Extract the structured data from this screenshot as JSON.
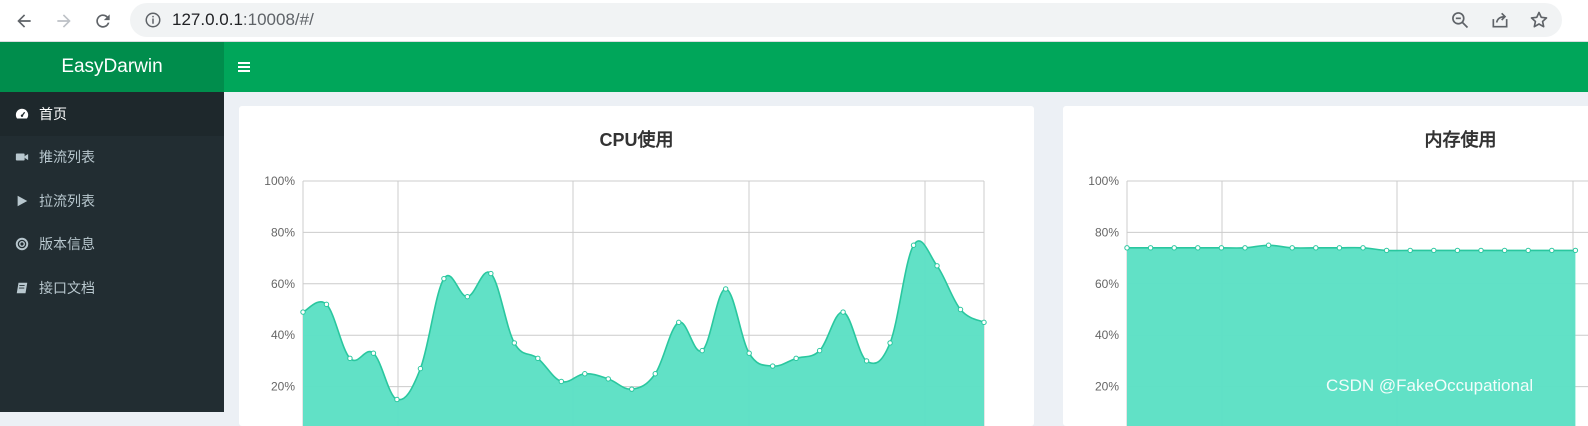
{
  "browser": {
    "url_host": "127.0.0.1",
    "url_rest": ":10008/#/"
  },
  "header": {
    "logo": "EasyDarwin"
  },
  "sidebar": {
    "items": [
      {
        "label": "首页",
        "icon": "dashboard-icon",
        "active": true
      },
      {
        "label": "推流列表",
        "icon": "video-camera-icon",
        "active": false
      },
      {
        "label": "拉流列表",
        "icon": "play-icon",
        "active": false
      },
      {
        "label": "版本信息",
        "icon": "life-ring-icon",
        "active": false
      },
      {
        "label": "接口文档",
        "icon": "book-icon",
        "active": false
      }
    ]
  },
  "colors": {
    "header": "#00a65a",
    "logo_bg": "#008d4c",
    "sidebar": "#222d32",
    "area_fill": "#5ce0c4",
    "area_line": "#2ac79f"
  },
  "chart_data": [
    {
      "type": "area",
      "title": "CPU使用",
      "ylim": [
        0,
        100
      ],
      "y_ticks": [
        "100%",
        "80%",
        "60%",
        "40%",
        "20%"
      ],
      "grid": true,
      "x": [
        0,
        1,
        2,
        3,
        4,
        5,
        6,
        7,
        8,
        9,
        10,
        11,
        12,
        13,
        14,
        15,
        16,
        17,
        18,
        19,
        20,
        21,
        22,
        23,
        24,
        25,
        26,
        27,
        28,
        29
      ],
      "values": [
        49,
        52,
        31,
        33,
        15,
        27,
        62,
        55,
        64,
        37,
        31,
        22,
        25,
        23,
        19,
        25,
        45,
        34,
        58,
        33,
        28,
        31,
        34,
        49,
        30,
        37,
        75,
        67,
        50,
        45
      ]
    },
    {
      "type": "area",
      "title": "内存使用",
      "ylim": [
        0,
        100
      ],
      "y_ticks": [
        "100%",
        "80%",
        "60%",
        "40%",
        "20%"
      ],
      "grid": true,
      "x": [
        0,
        1,
        2,
        3,
        4,
        5,
        6,
        7,
        8,
        9,
        10,
        11,
        12,
        13,
        14,
        15,
        16,
        17,
        18,
        19
      ],
      "values": [
        74,
        74,
        74,
        74,
        74,
        74,
        75,
        74,
        74,
        74,
        74,
        73,
        73,
        73,
        73,
        73,
        73,
        73,
        73,
        73
      ]
    }
  ],
  "watermark": "CSDN @FakeOccupational"
}
